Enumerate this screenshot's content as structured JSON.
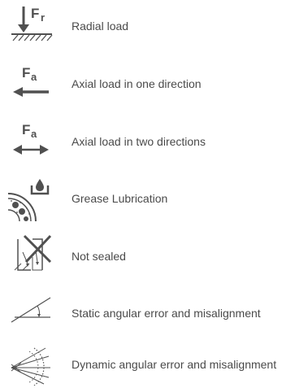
{
  "legend": {
    "items": [
      {
        "icon": "radial-load-icon",
        "label": "Radial load",
        "icon_text": "F",
        "icon_subscript": "r"
      },
      {
        "icon": "axial-load-one-direction-icon",
        "label": "Axial load in one direction",
        "icon_text": "F",
        "icon_subscript": "a"
      },
      {
        "icon": "axial-load-two-directions-icon",
        "label": "Axial load in two directions",
        "icon_text": "F",
        "icon_subscript": "a"
      },
      {
        "icon": "grease-lubrication-icon",
        "label": "Grease Lubrication"
      },
      {
        "icon": "not-sealed-icon",
        "label": "Not sealed"
      },
      {
        "icon": "static-angular-error-icon",
        "label": "Static angular error and misalignment"
      },
      {
        "icon": "dynamic-angular-error-icon",
        "label": "Dynamic angular error and misalignment"
      }
    ]
  },
  "colors": {
    "icon": "#505050",
    "text": "#4a4a4a",
    "background": "#ffffff"
  }
}
